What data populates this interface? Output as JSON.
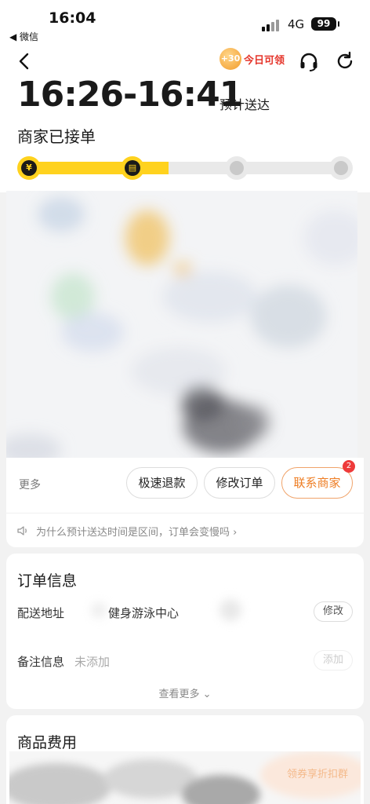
{
  "status_bar": {
    "time": "16:04",
    "back_app": "◀ 微信",
    "network": "4G",
    "battery": "99"
  },
  "header": {
    "promo_amount": "+30",
    "promo_label": "今日可领",
    "icons": [
      "back-icon",
      "headset-icon",
      "refresh-icon"
    ]
  },
  "delivery": {
    "eta_range": "16:26-16:41",
    "eta_label": "预计送达",
    "status": "商家已接单",
    "progress": 0.45,
    "steps": [
      {
        "state": "done",
        "glyph": "¥",
        "icon": "paid-icon"
      },
      {
        "state": "done",
        "glyph": "▤",
        "icon": "merchant-icon"
      },
      {
        "state": "todo",
        "icon": "rider-icon"
      },
      {
        "state": "todo",
        "icon": "delivered-icon"
      }
    ]
  },
  "actions": {
    "more": "更多",
    "refund": "极速退款",
    "modify": "修改订单",
    "contact": "联系商家",
    "contact_badge": "2"
  },
  "tip": "为什么预计送达时间是区间，订单会变慢吗 ›",
  "order_info": {
    "title": "订单信息",
    "address_label": "配送地址",
    "address_value": "健身游泳中心",
    "address_action": "修改",
    "note_label": "备注信息",
    "note_value": "未添加",
    "note_action": "添加",
    "see_more": "查看更多 ⌄"
  },
  "goods": {
    "title": "商品费用",
    "ad_text": "领券享折扣群"
  },
  "colors": {
    "accent": "#ffd21e",
    "primary_text": "#ee7d23",
    "badge": "#ee3a3a",
    "promo": "#e5352b"
  }
}
